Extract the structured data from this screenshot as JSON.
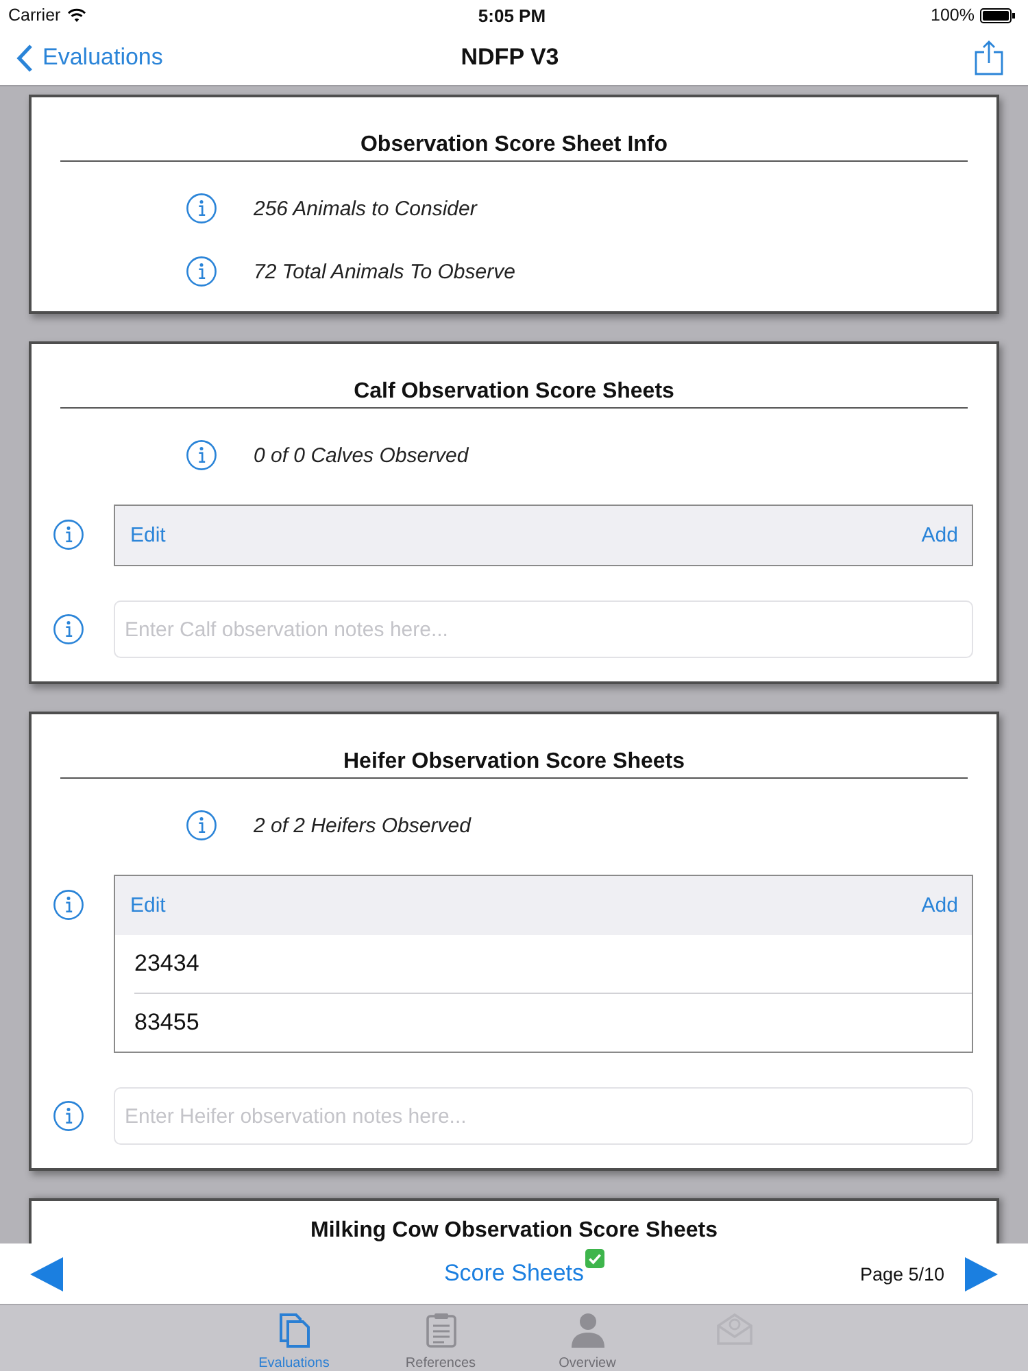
{
  "status_bar": {
    "carrier": "Carrier",
    "time": "5:05 PM",
    "battery": "100%"
  },
  "nav_bar": {
    "back": "Evaluations",
    "title": "NDFP V3"
  },
  "sections": [
    {
      "kind": "info",
      "title": "Observation Score Sheet Info",
      "facts": [
        "256 Animals to Consider",
        "72 Total Animals To Observe"
      ]
    },
    {
      "kind": "score_sheet",
      "title": "Calf Observation Score Sheets",
      "facts": [
        "0 of 0 Calves Observed"
      ],
      "table": {
        "edit": "Edit",
        "add": "Add"
      },
      "notes": {
        "placeholder": "Enter Calf observation notes here..."
      }
    },
    {
      "kind": "score_sheet",
      "title": "Heifer Observation Score Sheets",
      "facts": [
        "2 of 2 Heifers Observed"
      ],
      "table": {
        "edit": "Edit",
        "add": "Add",
        "rows": [
          "23434",
          "83455"
        ]
      },
      "notes": {
        "placeholder": "Enter Heifer observation notes here..."
      }
    },
    {
      "kind": "cut_off",
      "title": "Milking Cow Observation Score Sheets"
    }
  ],
  "page_bar": {
    "title": "Score Sheets",
    "complete": true,
    "page": "Page 5/10"
  },
  "tab_bar": [
    {
      "label": "Evaluations",
      "selected": true,
      "disabled": false
    },
    {
      "label": "References",
      "selected": false,
      "disabled": false
    },
    {
      "label": "Overview",
      "selected": false,
      "disabled": false
    },
    {
      "selected": false,
      "disabled": true
    }
  ]
}
